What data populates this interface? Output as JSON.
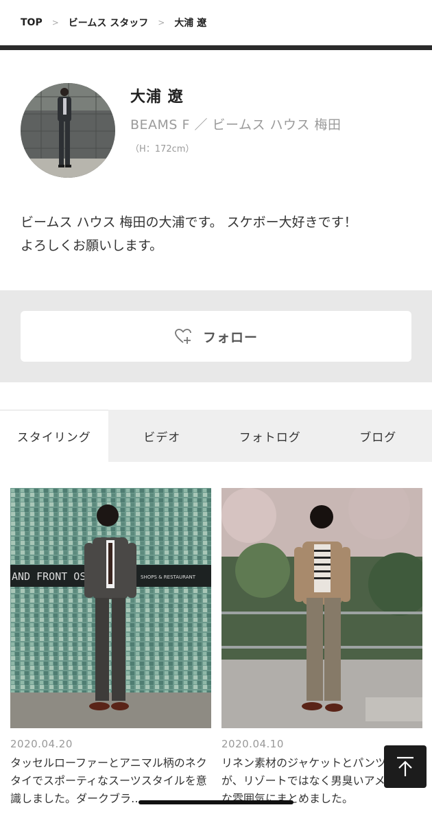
{
  "breadcrumb": {
    "items": [
      "TOP",
      "ビームス スタッフ",
      "大浦 遼"
    ],
    "separator": ">"
  },
  "profile": {
    "name": "大浦 遼",
    "shop": "BEAMS F ／ ビームス ハウス 梅田",
    "height": "（H：172cm）",
    "bio_line1": "ビームス ハウス 梅田の大浦です。 スケボー大好きです！",
    "bio_line2": "よろしくお願いします。"
  },
  "follow": {
    "label": "フォロー",
    "icon": "heart-plus-icon"
  },
  "tabs": [
    {
      "label": "スタイリング",
      "active": true
    },
    {
      "label": "ビデオ",
      "active": false
    },
    {
      "label": "フォトログ",
      "active": false
    },
    {
      "label": "ブログ",
      "active": false
    }
  ],
  "posts": [
    {
      "date": "2020.04.20",
      "text": "タッセルローファーとアニマル柄のネクタイでスポーティなスーツスタイルを意識しました。ダークブラ…",
      "sign_text_1": "AND FRONT OSA",
      "sign_text_2": "SHOPS & RESTAURANT"
    },
    {
      "date": "2020.04.10",
      "text": "リネン素材のジャケットとパンツですが、リゾートではなく男臭いアメリカンな雰囲気にまとめました。"
    }
  ],
  "colors": {
    "topbar": "#2b2b2b",
    "follow_area": "#e8e8e8",
    "tab_inactive": "#efefef",
    "to_top_button": "#1c1c1c"
  },
  "to_top": {
    "icon": "arrow-up-to-top-icon"
  }
}
